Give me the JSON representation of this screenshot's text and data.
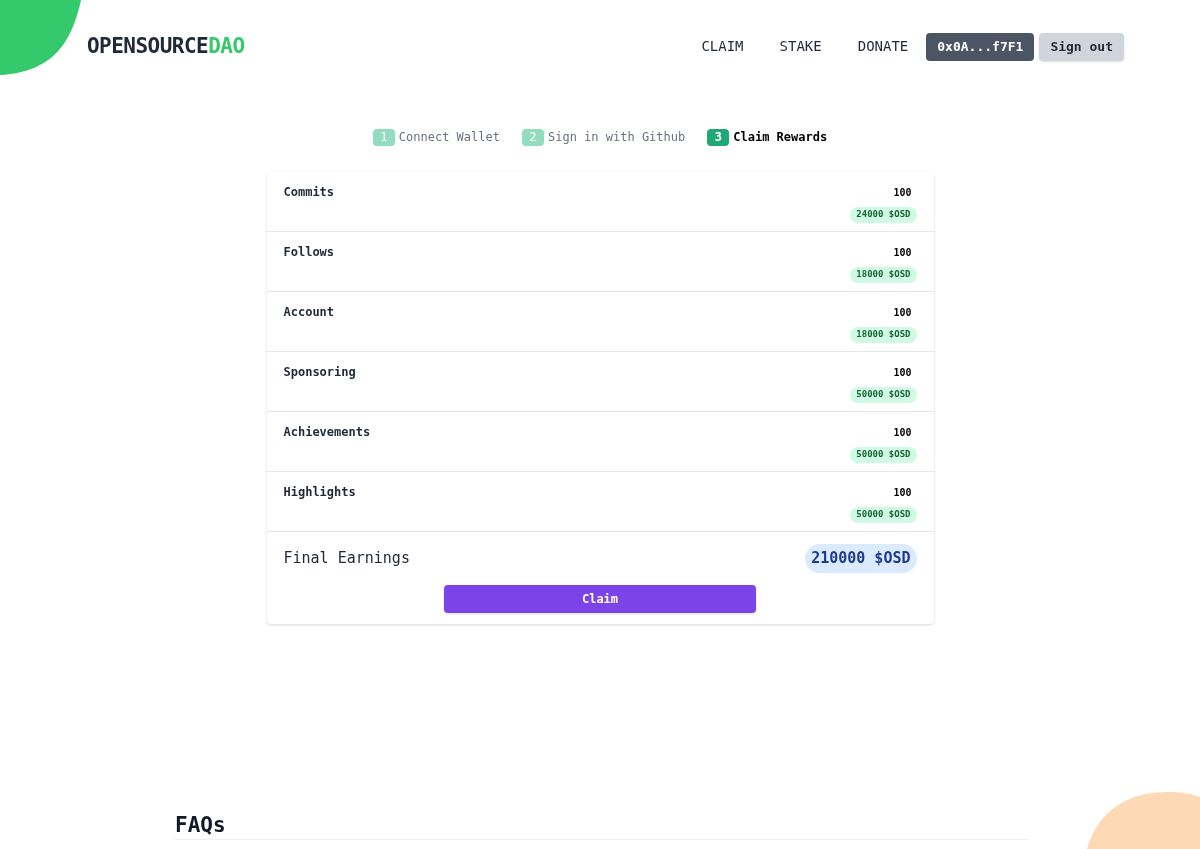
{
  "logo": {
    "main": "OPENSOURCE",
    "accent": "DAO"
  },
  "nav": [
    {
      "label": "CLAIM"
    },
    {
      "label": "STAKE"
    },
    {
      "label": "DONATE"
    }
  ],
  "wallet": "0x0A...f7F1",
  "sign_out": "Sign out",
  "steps": [
    {
      "number": "1",
      "label": "Connect Wallet",
      "selected": false
    },
    {
      "number": "2",
      "label": "Sign in with Github",
      "selected": false
    },
    {
      "number": "3",
      "label": "Claim Rewards",
      "selected": true
    }
  ],
  "rewards": [
    {
      "name": "Commits",
      "count": "100",
      "amount": "24000 $OSD"
    },
    {
      "name": "Follows",
      "count": "100",
      "amount": "18000 $OSD"
    },
    {
      "name": "Account",
      "count": "100",
      "amount": "18000 $OSD"
    },
    {
      "name": "Sponsoring",
      "count": "100",
      "amount": "50000 $OSD"
    },
    {
      "name": "Achievements",
      "count": "100",
      "amount": "50000 $OSD"
    },
    {
      "name": "Highlights",
      "count": "100",
      "amount": "50000 $OSD"
    }
  ],
  "final": {
    "label": "Final Earnings",
    "amount": "210000 $OSD"
  },
  "claim_button": "Claim",
  "faq_title": "FAQs"
}
